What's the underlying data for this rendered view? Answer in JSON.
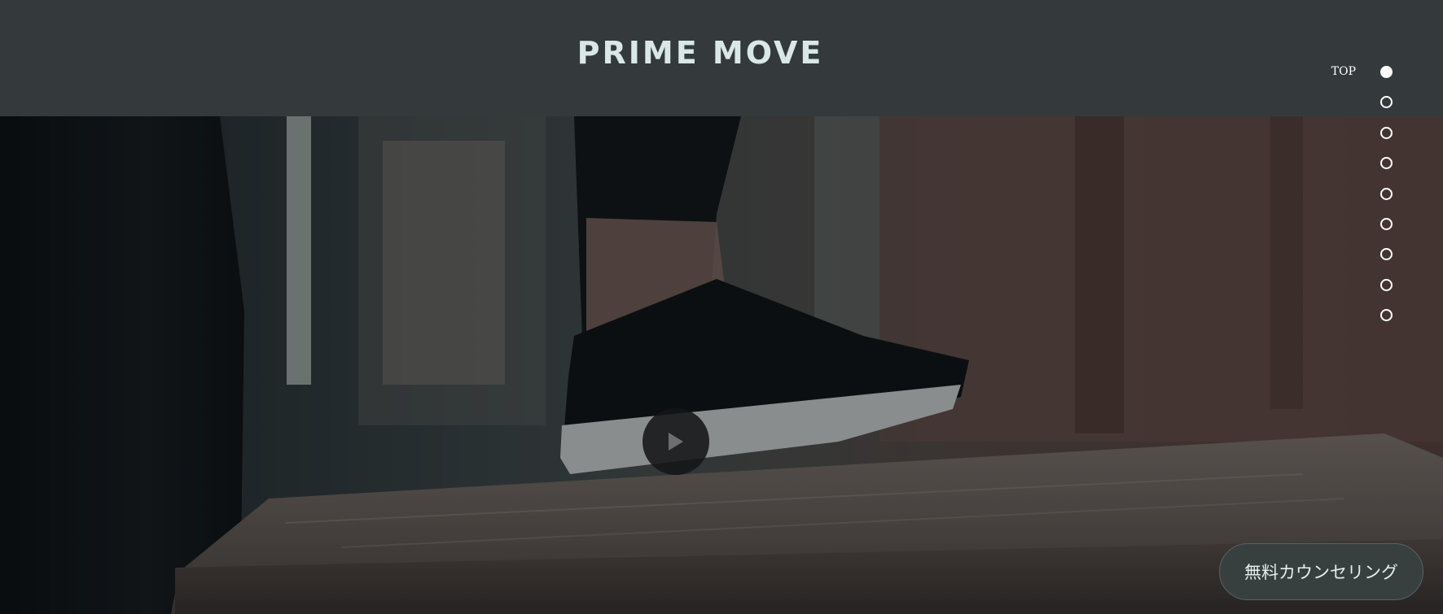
{
  "header": {
    "logo_text": "PRIME MOVE"
  },
  "dot_nav": {
    "items": [
      {
        "label": "TOP",
        "active": true
      },
      {
        "label": "",
        "active": false
      },
      {
        "label": "",
        "active": false
      },
      {
        "label": "",
        "active": false
      },
      {
        "label": "",
        "active": false
      },
      {
        "label": "",
        "active": false
      },
      {
        "label": "",
        "active": false
      },
      {
        "label": "",
        "active": false
      },
      {
        "label": "",
        "active": false
      }
    ]
  },
  "hero": {
    "play_icon": "play-icon"
  },
  "cta": {
    "label": "無料カウンセリング"
  },
  "colors": {
    "header_bg": "#343a3b",
    "logo": "#d9e8e6",
    "dot": "#ffffff",
    "cta_bg": "#383f3f"
  }
}
